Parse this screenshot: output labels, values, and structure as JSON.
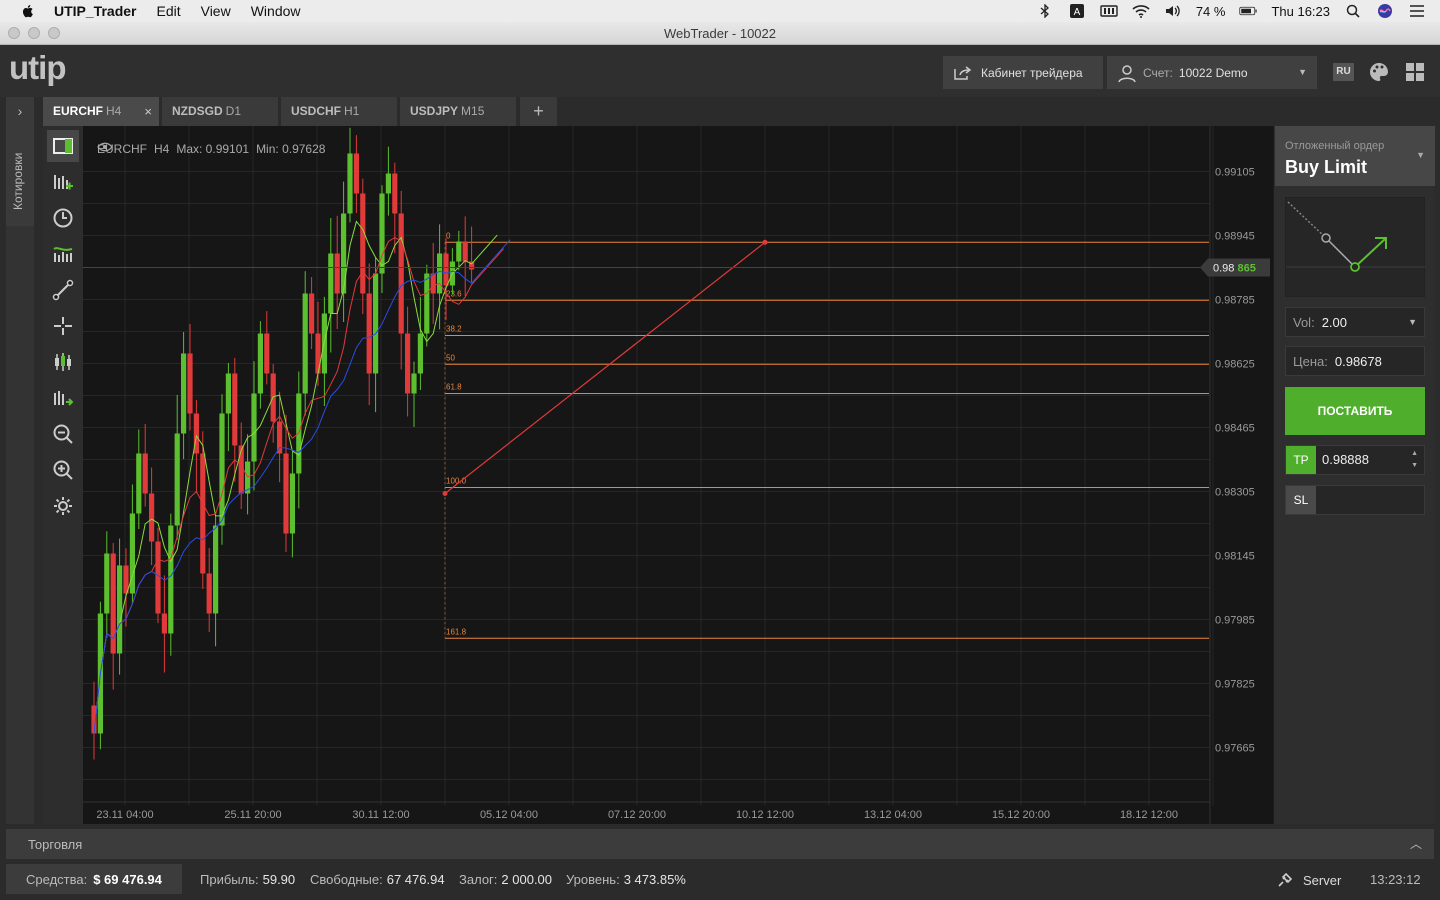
{
  "menubar": {
    "items": [
      "UTIP_Trader",
      "Edit",
      "View",
      "Window"
    ],
    "battery": "74 %",
    "clock": "Thu 16:23"
  },
  "window": {
    "title": "WebTrader - 10022"
  },
  "header": {
    "logo": "utip",
    "cabinet_label": "Кабинет трейдера",
    "account_label": "Счет:",
    "account_value": "10022 Demo",
    "lang": "RU"
  },
  "tabs": [
    {
      "pair": "EURCHF",
      "tf": "H4",
      "active": true
    },
    {
      "pair": "NZDSGD",
      "tf": "D1"
    },
    {
      "pair": "USDCHF",
      "tf": "H1"
    },
    {
      "pair": "USDJPY",
      "tf": "M15"
    }
  ],
  "add_tab": "+",
  "sidebar": {
    "quotes_label": "Котировки"
  },
  "chart_info": {
    "symbol": "EURCHF",
    "tf": "H4",
    "max": "Max: 0.99101",
    "min": "Min: 0.97628"
  },
  "chart_data": {
    "type": "candlestick",
    "y_ticks": [
      "0.99105",
      "0.98945",
      "0.98785",
      "0.98625",
      "0.98465",
      "0.98305",
      "0.98145",
      "0.97985",
      "0.97825",
      "0.97665"
    ],
    "x_ticks": [
      "23.11 04:00",
      "25.11 20:00",
      "30.11 12:00",
      "05.12 04:00",
      "07.12 20:00",
      "10.12 12:00",
      "13.12 04:00",
      "15.12 20:00",
      "18.12 12:00"
    ],
    "ylim": [
      0.9757,
      0.9918
    ],
    "current_price": {
      "main": "0.98",
      "pips": "865",
      "value": 0.98865
    },
    "fibonacci": [
      {
        "label": "0",
        "price": 0.98928
      },
      {
        "label": "23.6",
        "price": 0.98783
      },
      {
        "label": "38.2",
        "price": 0.98695
      },
      {
        "label": "50",
        "price": 0.98623
      },
      {
        "label": "61.8",
        "price": 0.9855
      },
      {
        "label": "100.0",
        "price": 0.98315
      },
      {
        "label": "161.8",
        "price": 0.97938
      }
    ],
    "colors": {
      "up": "#5bbf2f",
      "down": "#e03a3a",
      "fib": "#e8863c",
      "ma_green": "#8bdc3c",
      "ma_red": "#e03a3a",
      "ma_blue": "#2b4de0"
    }
  },
  "order": {
    "type_label": "Отложенный ордер",
    "type_value": "Buy Limit",
    "vol_label": "Vol:",
    "vol_value": "2.00",
    "price_label": "Цена:",
    "price_value": "0.98678",
    "place_label": "ПОСТАВИТЬ",
    "tp_label": "TP",
    "tp_value": "0.98888",
    "sl_label": "SL",
    "sl_value": ""
  },
  "trade_bar": {
    "label": "Торговля"
  },
  "status": {
    "funds_label": "Средства:",
    "funds_value": "$ 69 476.94",
    "profit_label": "Прибыль:",
    "profit_value": "59.90",
    "free_label": "Свободные:",
    "free_value": "67 476.94",
    "margin_label": "Залог:",
    "margin_value": "2 000.00",
    "level_label": "Уровень:",
    "level_value": "3 473.85%",
    "server_label": "Server",
    "time": "13:23:12"
  }
}
